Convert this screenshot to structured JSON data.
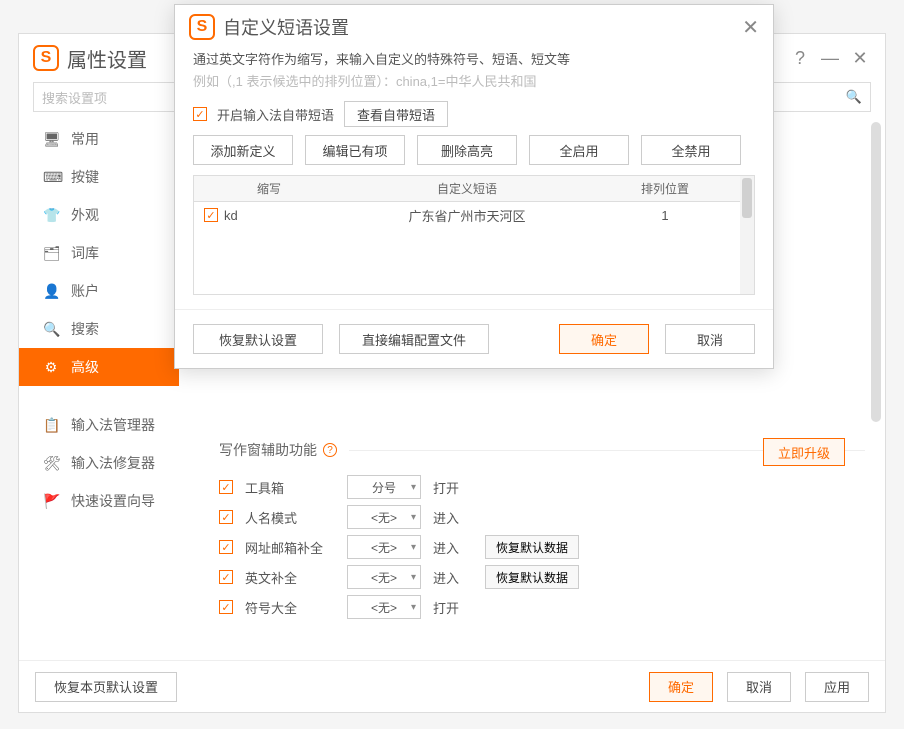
{
  "main": {
    "title": "属性设置",
    "search_placeholder": "搜索设置项",
    "help": "?",
    "sidebar": [
      {
        "icon": "🖥",
        "label": "常用"
      },
      {
        "icon": "⌨",
        "label": "按键"
      },
      {
        "icon": "👕",
        "label": "外观"
      },
      {
        "icon": "🗂",
        "label": "词库"
      },
      {
        "icon": "👤",
        "label": "账户"
      },
      {
        "icon": "🔍",
        "label": "搜索"
      },
      {
        "icon": "⚙",
        "label": "高级",
        "active": true
      }
    ],
    "sidebar2": [
      {
        "icon": "📋",
        "label": "输入法管理器"
      },
      {
        "icon": "🛠",
        "label": "输入法修复器"
      },
      {
        "icon": "🚩",
        "label": "快速设置向导"
      }
    ],
    "upgrade": "立即升级",
    "aux_title": "写作窗辅助功能",
    "aux_rows": [
      {
        "label": "工具箱",
        "select": "分号",
        "action": "打开",
        "restore": ""
      },
      {
        "label": "人名模式",
        "select": "<无>",
        "action": "进入",
        "restore": ""
      },
      {
        "label": "网址邮箱补全",
        "select": "<无>",
        "action": "进入",
        "restore": "恢复默认数据"
      },
      {
        "label": "英文补全",
        "select": "<无>",
        "action": "进入",
        "restore": "恢复默认数据"
      },
      {
        "label": "符号大全",
        "select": "<无>",
        "action": "打开",
        "restore": ""
      }
    ],
    "footer": {
      "restore": "恢复本页默认设置",
      "ok": "确定",
      "cancel": "取消",
      "apply": "应用"
    }
  },
  "dialog": {
    "title": "自定义短语设置",
    "hint1": "通过英文字符作为缩写，来输入自定义的特殊符号、短语、短文等",
    "hint2": "例如（,1 表示候选中的排列位置）：china,1=中华人民共和国",
    "enable_label": "开启输入法自带短语",
    "view_builtin": "查看自带短语",
    "toolbar": [
      "添加新定义",
      "编辑已有项",
      "删除高亮",
      "全启用",
      "全禁用"
    ],
    "th": [
      "缩写",
      "自定义短语",
      "排列位置"
    ],
    "rows": [
      {
        "abbr": "kd",
        "phrase": "广东省广州市天河区",
        "pos": "1"
      }
    ],
    "footer": {
      "restore": "恢复默认设置",
      "editfile": "直接编辑配置文件",
      "ok": "确定",
      "cancel": "取消"
    }
  }
}
